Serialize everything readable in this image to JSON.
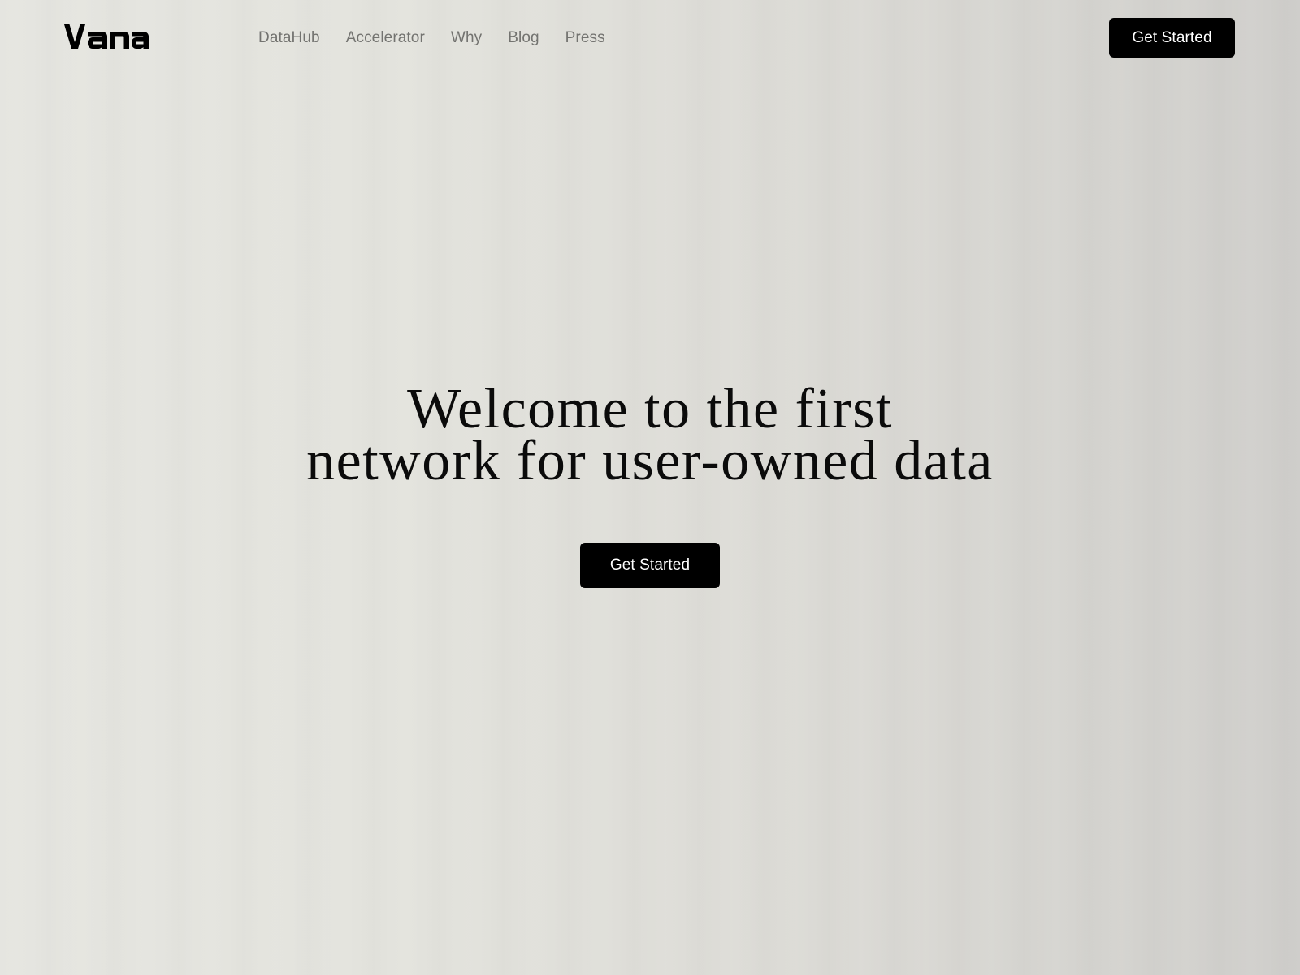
{
  "brand": {
    "logo_text": "vana",
    "logo_icon": "vana-wordmark"
  },
  "nav": {
    "links": [
      {
        "label": "DataHub"
      },
      {
        "label": "Accelerator"
      },
      {
        "label": "Why"
      },
      {
        "label": "Blog"
      },
      {
        "label": "Press"
      }
    ],
    "cta_label": "Get Started"
  },
  "hero": {
    "title_line1": "Welcome to the first",
    "title_line2": "network for user-owned data",
    "cta_label": "Get Started"
  },
  "colors": {
    "background_left": "#e5e5e0",
    "background_right": "#cfcecb",
    "nav_link": "#737370",
    "button_bg": "#000000",
    "button_text": "#ffffff",
    "heading": "#0b0b0b"
  }
}
